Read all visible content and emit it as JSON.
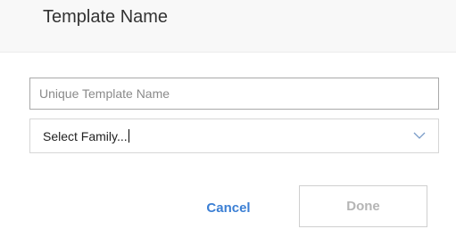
{
  "header": {
    "title": "Template Name"
  },
  "form": {
    "name_placeholder": "Unique Template Name",
    "name_value": "",
    "family_select_text": "Select Family...",
    "family_chevron_icon": "chevron-down-icon"
  },
  "actions": {
    "cancel_label": "Cancel",
    "done_label": "Done"
  },
  "colors": {
    "link_blue": "#3b7fd4",
    "disabled_text": "#b5b5b5",
    "header_background": "#f8f8f8"
  }
}
